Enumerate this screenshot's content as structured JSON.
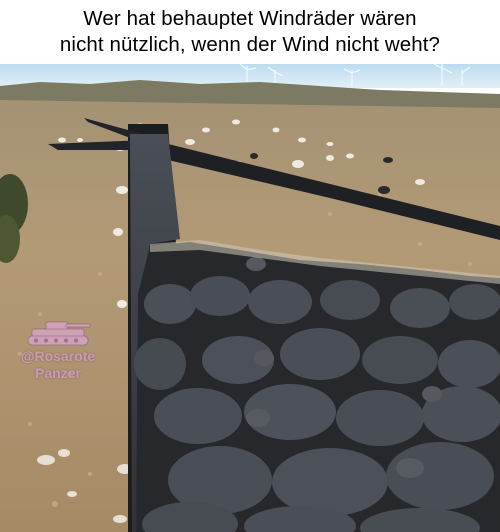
{
  "caption": {
    "line1": "Wer hat behauptet Windräder wären",
    "line2": "nicht nützlich, wenn der Wind nicht weht?"
  },
  "watermark": {
    "handle": "@Rosarote",
    "name": "Panzer"
  },
  "colors": {
    "sky": "#cfe6f3",
    "field": "#b49a74",
    "shadow": "#1c1d20",
    "sheep_in_shade": "#3e4249",
    "watermark": "#d7a5c8"
  }
}
